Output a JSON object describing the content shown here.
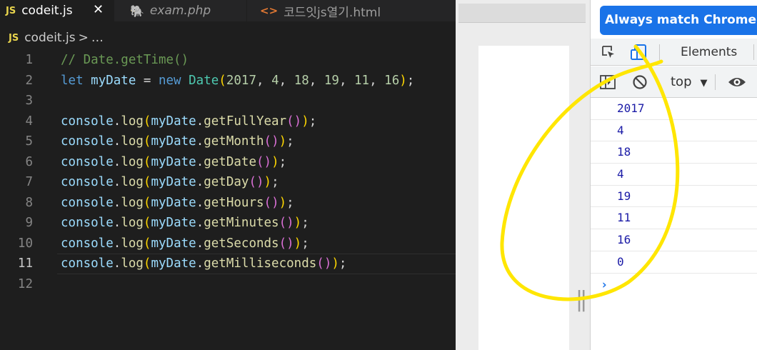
{
  "editor": {
    "tabs": [
      {
        "label": "codeit.js",
        "icon": "JS",
        "close": "✕"
      },
      {
        "label": "exam.php",
        "icon": "🐘"
      },
      {
        "label": "코드잇js열기.html",
        "icon": "<>"
      }
    ],
    "breadcrumb": {
      "icon": "JS",
      "file": "codeit.js",
      "sep": ">",
      "rest": "…"
    },
    "current_line": 11,
    "lines": [
      {
        "n": "1",
        "tokens": [
          [
            "c",
            "// Date.getTime()"
          ]
        ]
      },
      {
        "n": "2",
        "tokens": [
          [
            "k",
            "let"
          ],
          [
            "o",
            " "
          ],
          [
            "v",
            "myDate"
          ],
          [
            "o",
            " = "
          ],
          [
            "k",
            "new"
          ],
          [
            "o",
            " "
          ],
          [
            "t",
            "Date"
          ],
          [
            "b1",
            "("
          ],
          [
            "u",
            "2017"
          ],
          [
            "o",
            ", "
          ],
          [
            "u",
            "4"
          ],
          [
            "o",
            ", "
          ],
          [
            "u",
            "18"
          ],
          [
            "o",
            ", "
          ],
          [
            "u",
            "19"
          ],
          [
            "o",
            ", "
          ],
          [
            "u",
            "11"
          ],
          [
            "o",
            ", "
          ],
          [
            "u",
            "16"
          ],
          [
            "b1",
            ")"
          ],
          [
            "o",
            ";"
          ]
        ]
      },
      {
        "n": "3",
        "tokens": []
      },
      {
        "n": "4",
        "tokens": [
          [
            "v",
            "console"
          ],
          [
            "o",
            "."
          ],
          [
            "f",
            "log"
          ],
          [
            "b1",
            "("
          ],
          [
            "v",
            "myDate"
          ],
          [
            "o",
            "."
          ],
          [
            "f",
            "getFullYear"
          ],
          [
            "b2",
            "()"
          ],
          [
            "b1",
            ")"
          ],
          [
            "o",
            ";"
          ]
        ]
      },
      {
        "n": "5",
        "tokens": [
          [
            "v",
            "console"
          ],
          [
            "o",
            "."
          ],
          [
            "f",
            "log"
          ],
          [
            "b1",
            "("
          ],
          [
            "v",
            "myDate"
          ],
          [
            "o",
            "."
          ],
          [
            "f",
            "getMonth"
          ],
          [
            "b2",
            "()"
          ],
          [
            "b1",
            ")"
          ],
          [
            "o",
            ";"
          ]
        ]
      },
      {
        "n": "6",
        "tokens": [
          [
            "v",
            "console"
          ],
          [
            "o",
            "."
          ],
          [
            "f",
            "log"
          ],
          [
            "b1",
            "("
          ],
          [
            "v",
            "myDate"
          ],
          [
            "o",
            "."
          ],
          [
            "f",
            "getDate"
          ],
          [
            "b2",
            "()"
          ],
          [
            "b1",
            ")"
          ],
          [
            "o",
            ";"
          ]
        ]
      },
      {
        "n": "7",
        "tokens": [
          [
            "v",
            "console"
          ],
          [
            "o",
            "."
          ],
          [
            "f",
            "log"
          ],
          [
            "b1",
            "("
          ],
          [
            "v",
            "myDate"
          ],
          [
            "o",
            "."
          ],
          [
            "f",
            "getDay"
          ],
          [
            "b2",
            "()"
          ],
          [
            "b1",
            ")"
          ],
          [
            "o",
            ";"
          ]
        ]
      },
      {
        "n": "8",
        "tokens": [
          [
            "v",
            "console"
          ],
          [
            "o",
            "."
          ],
          [
            "f",
            "log"
          ],
          [
            "b1",
            "("
          ],
          [
            "v",
            "myDate"
          ],
          [
            "o",
            "."
          ],
          [
            "f",
            "getHours"
          ],
          [
            "b2",
            "()"
          ],
          [
            "b1",
            ")"
          ],
          [
            "o",
            ";"
          ]
        ]
      },
      {
        "n": "9",
        "tokens": [
          [
            "v",
            "console"
          ],
          [
            "o",
            "."
          ],
          [
            "f",
            "log"
          ],
          [
            "b1",
            "("
          ],
          [
            "v",
            "myDate"
          ],
          [
            "o",
            "."
          ],
          [
            "f",
            "getMinutes"
          ],
          [
            "b2",
            "()"
          ],
          [
            "b1",
            ")"
          ],
          [
            "o",
            ";"
          ]
        ]
      },
      {
        "n": "10",
        "tokens": [
          [
            "v",
            "console"
          ],
          [
            "o",
            "."
          ],
          [
            "f",
            "log"
          ],
          [
            "b1",
            "("
          ],
          [
            "v",
            "myDate"
          ],
          [
            "o",
            "."
          ],
          [
            "f",
            "getSeconds"
          ],
          [
            "b2",
            "()"
          ],
          [
            "b1",
            ")"
          ],
          [
            "o",
            ";"
          ]
        ]
      },
      {
        "n": "11",
        "tokens": [
          [
            "v",
            "console"
          ],
          [
            "o",
            "."
          ],
          [
            "f",
            "log"
          ],
          [
            "b1",
            "("
          ],
          [
            "v",
            "myDate"
          ],
          [
            "o",
            "."
          ],
          [
            "f",
            "getMilliseconds"
          ],
          [
            "b2",
            "()"
          ],
          [
            "b1",
            ")"
          ],
          [
            "o",
            ";"
          ]
        ]
      },
      {
        "n": "12",
        "tokens": []
      }
    ]
  },
  "browser": {
    "resize_handle": "||"
  },
  "devtools": {
    "banner": "Always match Chrome's language",
    "tabs": {
      "elements": "Elements"
    },
    "icons": [
      "inspect-icon",
      "device-toggle-icon",
      "sidebar-icon",
      "clear-console-icon",
      "eye-icon"
    ],
    "context": {
      "label": "top",
      "caret": "▼"
    },
    "console_output": [
      "2017",
      "4",
      "18",
      "4",
      "19",
      "11",
      "16",
      "0"
    ],
    "prompt": "›"
  },
  "colors": {
    "editor_bg": "#1e1e1e",
    "devtools_accent": "#1a73e8",
    "console_value": "#1a1aa6",
    "annotation": "#ffe600"
  }
}
